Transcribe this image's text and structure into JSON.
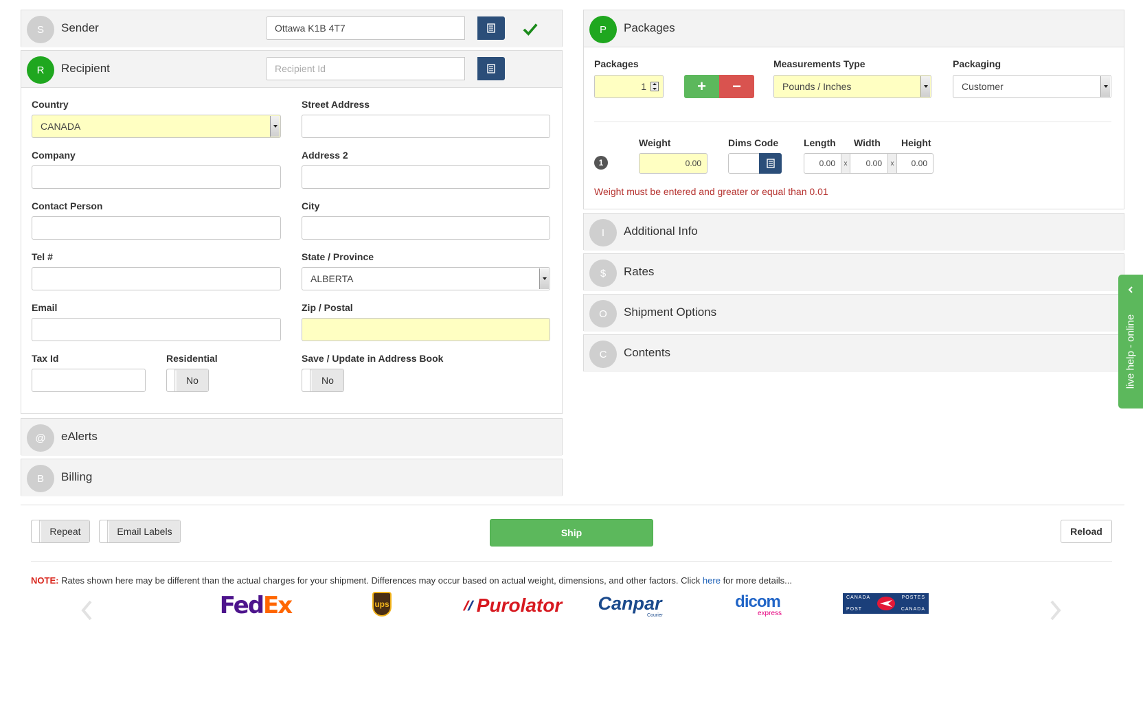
{
  "sender": {
    "badge": "S",
    "title": "Sender",
    "value": "Ottawa K1B 4T7"
  },
  "recipient": {
    "badge": "R",
    "title": "Recipient",
    "id_placeholder": "Recipient Id",
    "country_label": "Country",
    "country_value": "CANADA",
    "street_label": "Street Address",
    "company_label": "Company",
    "address2_label": "Address 2",
    "contact_label": "Contact Person",
    "city_label": "City",
    "tel_label": "Tel #",
    "state_label": "State / Province",
    "state_value": "ALBERTA",
    "email_label": "Email",
    "zip_label": "Zip / Postal",
    "taxid_label": "Tax Id",
    "residential_label": "Residential",
    "residential_value": "No",
    "save_label": "Save / Update in Address Book",
    "save_value": "No"
  },
  "ealerts": {
    "badge": "@",
    "title": "eAlerts"
  },
  "billing": {
    "badge": "B",
    "title": "Billing"
  },
  "packages": {
    "badge": "P",
    "title": "Packages",
    "count_label": "Packages",
    "count_value": "1",
    "plus": "+",
    "minus": "−",
    "meas_label": "Measurements Type",
    "meas_value": "Pounds / Inches",
    "packaging_label": "Packaging",
    "packaging_value": "Customer",
    "row_index": "1",
    "weight_label": "Weight",
    "weight_value": "0.00",
    "dims_label": "Dims Code",
    "length_label": "Length",
    "length_value": "0.00",
    "width_label": "Width",
    "width_value": "0.00",
    "height_label": "Height",
    "height_value": "0.00",
    "x": "x",
    "error": "Weight must be entered and greater or equal than 0.01"
  },
  "additional": {
    "badge": "I",
    "title": "Additional Info"
  },
  "rates": {
    "badge": "$",
    "title": "Rates"
  },
  "options": {
    "badge": "O",
    "title": "Shipment Options"
  },
  "contents": {
    "badge": "C",
    "title": "Contents"
  },
  "livehelp": {
    "label": "live help - online"
  },
  "actions": {
    "repeat": "Repeat",
    "email_labels": "Email Labels",
    "ship": "Ship",
    "reload": "Reload"
  },
  "note": {
    "prefix": "NOTE:",
    "text": " Rates shown here may be different than the actual charges for your shipment. Differences may occur based on actual weight, dimensions, and other factors. Click ",
    "link": "here",
    "suffix": " for more details..."
  },
  "carriers": {
    "fedex_a": "Fed",
    "fedex_b": "Ex",
    "ups": "ups",
    "purolator": "Purolator",
    "canpar": "Canpar",
    "canpar_sub": "Courier",
    "dicom": "dicom",
    "dicom_sub": "express",
    "cp_tl": "CANADA",
    "cp_tr": "POSTES",
    "cp_bl": "POST",
    "cp_br": "CANADA"
  },
  "colors": {
    "green": "#1fa71f",
    "ship": "#5cb85c",
    "navy": "#2b4e79",
    "yellow": "#ffffc2",
    "error": "#b5312e",
    "minus": "#d9534f"
  }
}
